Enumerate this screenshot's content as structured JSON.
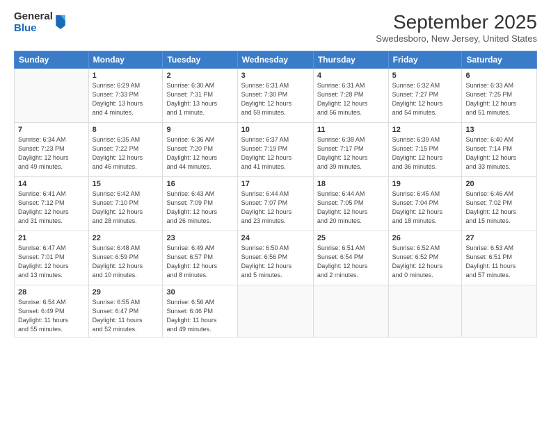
{
  "logo": {
    "general": "General",
    "blue": "Blue"
  },
  "title": "September 2025",
  "location": "Swedesboro, New Jersey, United States",
  "days_of_week": [
    "Sunday",
    "Monday",
    "Tuesday",
    "Wednesday",
    "Thursday",
    "Friday",
    "Saturday"
  ],
  "weeks": [
    [
      {
        "day": "",
        "info": ""
      },
      {
        "day": "1",
        "info": "Sunrise: 6:29 AM\nSunset: 7:33 PM\nDaylight: 13 hours\nand 4 minutes."
      },
      {
        "day": "2",
        "info": "Sunrise: 6:30 AM\nSunset: 7:31 PM\nDaylight: 13 hours\nand 1 minute."
      },
      {
        "day": "3",
        "info": "Sunrise: 6:31 AM\nSunset: 7:30 PM\nDaylight: 12 hours\nand 59 minutes."
      },
      {
        "day": "4",
        "info": "Sunrise: 6:31 AM\nSunset: 7:28 PM\nDaylight: 12 hours\nand 56 minutes."
      },
      {
        "day": "5",
        "info": "Sunrise: 6:32 AM\nSunset: 7:27 PM\nDaylight: 12 hours\nand 54 minutes."
      },
      {
        "day": "6",
        "info": "Sunrise: 6:33 AM\nSunset: 7:25 PM\nDaylight: 12 hours\nand 51 minutes."
      }
    ],
    [
      {
        "day": "7",
        "info": "Sunrise: 6:34 AM\nSunset: 7:23 PM\nDaylight: 12 hours\nand 49 minutes."
      },
      {
        "day": "8",
        "info": "Sunrise: 6:35 AM\nSunset: 7:22 PM\nDaylight: 12 hours\nand 46 minutes."
      },
      {
        "day": "9",
        "info": "Sunrise: 6:36 AM\nSunset: 7:20 PM\nDaylight: 12 hours\nand 44 minutes."
      },
      {
        "day": "10",
        "info": "Sunrise: 6:37 AM\nSunset: 7:19 PM\nDaylight: 12 hours\nand 41 minutes."
      },
      {
        "day": "11",
        "info": "Sunrise: 6:38 AM\nSunset: 7:17 PM\nDaylight: 12 hours\nand 39 minutes."
      },
      {
        "day": "12",
        "info": "Sunrise: 6:39 AM\nSunset: 7:15 PM\nDaylight: 12 hours\nand 36 minutes."
      },
      {
        "day": "13",
        "info": "Sunrise: 6:40 AM\nSunset: 7:14 PM\nDaylight: 12 hours\nand 33 minutes."
      }
    ],
    [
      {
        "day": "14",
        "info": "Sunrise: 6:41 AM\nSunset: 7:12 PM\nDaylight: 12 hours\nand 31 minutes."
      },
      {
        "day": "15",
        "info": "Sunrise: 6:42 AM\nSunset: 7:10 PM\nDaylight: 12 hours\nand 28 minutes."
      },
      {
        "day": "16",
        "info": "Sunrise: 6:43 AM\nSunset: 7:09 PM\nDaylight: 12 hours\nand 26 minutes."
      },
      {
        "day": "17",
        "info": "Sunrise: 6:44 AM\nSunset: 7:07 PM\nDaylight: 12 hours\nand 23 minutes."
      },
      {
        "day": "18",
        "info": "Sunrise: 6:44 AM\nSunset: 7:05 PM\nDaylight: 12 hours\nand 20 minutes."
      },
      {
        "day": "19",
        "info": "Sunrise: 6:45 AM\nSunset: 7:04 PM\nDaylight: 12 hours\nand 18 minutes."
      },
      {
        "day": "20",
        "info": "Sunrise: 6:46 AM\nSunset: 7:02 PM\nDaylight: 12 hours\nand 15 minutes."
      }
    ],
    [
      {
        "day": "21",
        "info": "Sunrise: 6:47 AM\nSunset: 7:01 PM\nDaylight: 12 hours\nand 13 minutes."
      },
      {
        "day": "22",
        "info": "Sunrise: 6:48 AM\nSunset: 6:59 PM\nDaylight: 12 hours\nand 10 minutes."
      },
      {
        "day": "23",
        "info": "Sunrise: 6:49 AM\nSunset: 6:57 PM\nDaylight: 12 hours\nand 8 minutes."
      },
      {
        "day": "24",
        "info": "Sunrise: 6:50 AM\nSunset: 6:56 PM\nDaylight: 12 hours\nand 5 minutes."
      },
      {
        "day": "25",
        "info": "Sunrise: 6:51 AM\nSunset: 6:54 PM\nDaylight: 12 hours\nand 2 minutes."
      },
      {
        "day": "26",
        "info": "Sunrise: 6:52 AM\nSunset: 6:52 PM\nDaylight: 12 hours\nand 0 minutes."
      },
      {
        "day": "27",
        "info": "Sunrise: 6:53 AM\nSunset: 6:51 PM\nDaylight: 11 hours\nand 57 minutes."
      }
    ],
    [
      {
        "day": "28",
        "info": "Sunrise: 6:54 AM\nSunset: 6:49 PM\nDaylight: 11 hours\nand 55 minutes."
      },
      {
        "day": "29",
        "info": "Sunrise: 6:55 AM\nSunset: 6:47 PM\nDaylight: 11 hours\nand 52 minutes."
      },
      {
        "day": "30",
        "info": "Sunrise: 6:56 AM\nSunset: 6:46 PM\nDaylight: 11 hours\nand 49 minutes."
      },
      {
        "day": "",
        "info": ""
      },
      {
        "day": "",
        "info": ""
      },
      {
        "day": "",
        "info": ""
      },
      {
        "day": "",
        "info": ""
      }
    ]
  ]
}
